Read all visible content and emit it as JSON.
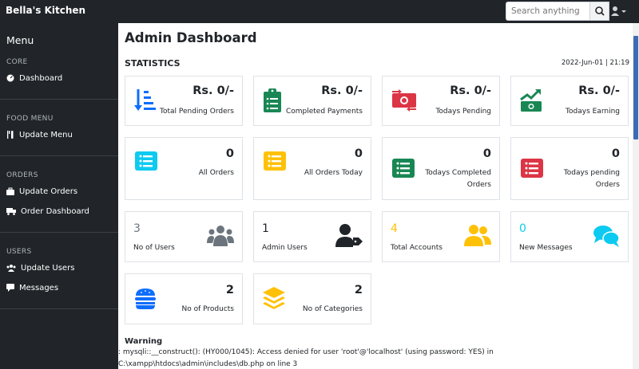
{
  "topbar": {
    "brand": "Bella's Kitchen",
    "search_placeholder": "Search anything",
    "search_icon": "search-icon",
    "user_icon": "user-icon"
  },
  "sidebar": {
    "title": "Menu",
    "sections": [
      {
        "heading": "CORE",
        "items": [
          {
            "label": "Dashboard",
            "icon": "dashboard-icon"
          }
        ]
      },
      {
        "heading": "FOOD MENU",
        "items": [
          {
            "label": "Update Menu",
            "icon": "utensils-icon"
          }
        ]
      },
      {
        "heading": "ORDERS",
        "items": [
          {
            "label": "Update Orders",
            "icon": "briefcase-icon"
          },
          {
            "label": "Order Dashboard",
            "icon": "truck-icon"
          }
        ]
      },
      {
        "heading": "USERS",
        "items": [
          {
            "label": "Update Users",
            "icon": "users-icon"
          },
          {
            "label": "Messages",
            "icon": "message-icon"
          }
        ]
      }
    ]
  },
  "main": {
    "title": "Admin Dashboard",
    "section": "STATISTICS",
    "datetime": "2022-Jun-01 | 21:19"
  },
  "cards": [
    {
      "value": "Rs. 0/-",
      "label": "Total Pending Orders",
      "icon": "sort-amount-icon",
      "color": "#0d6efd"
    },
    {
      "value": "Rs. 0/-",
      "label": "Completed Payments",
      "icon": "clipboard-list-icon",
      "color": "#198754"
    },
    {
      "value": "Rs. 0/-",
      "label": "Todays Pending",
      "icon": "money-exchange-icon",
      "color": "#dc3545"
    },
    {
      "value": "Rs. 0/-",
      "label": "Todays Earning",
      "icon": "money-trend-icon",
      "color": "#198754"
    },
    {
      "value": "0",
      "label": "All Orders",
      "icon": "list-icon",
      "color": "#0dcaf0"
    },
    {
      "value": "0",
      "label": "All Orders Today",
      "icon": "list-icon",
      "color": "#ffc107"
    },
    {
      "value": "0",
      "label_line1": "Todays Completed",
      "label_line2": "Orders",
      "icon": "list-icon",
      "color": "#198754"
    },
    {
      "value": "0",
      "label_line1": "Todays pending",
      "label_line2": "Orders",
      "icon": "list-icon",
      "color": "#dc3545"
    },
    {
      "value": "3",
      "label": "No of Users",
      "icon": "users-icon",
      "color": "#6c757d"
    },
    {
      "value": "1",
      "label": "Admin Users",
      "icon": "user-tag-icon",
      "color": "#212529"
    },
    {
      "value": "4",
      "label": "Total Accounts",
      "icon": "user-friends-icon",
      "color": "#ffc107"
    },
    {
      "value": "0",
      "label": "New Messages",
      "icon": "comments-icon",
      "color": "#0dcaf0"
    },
    {
      "value": "2",
      "label": "No of Products",
      "icon": "hamburger-icon",
      "color": "#0d6efd"
    },
    {
      "value": "2",
      "label": "No of Categories",
      "icon": "layer-group-icon",
      "color": "#ffc107"
    }
  ],
  "warning": {
    "title": "Warning",
    "text": ": mysqli::__construct(): (HY000/1045): Access denied for user 'root'@'localhost' (using password: YES) in",
    "text2": "C:\\xampp\\htdocs\\admin\\includes\\db.php on line 3"
  }
}
